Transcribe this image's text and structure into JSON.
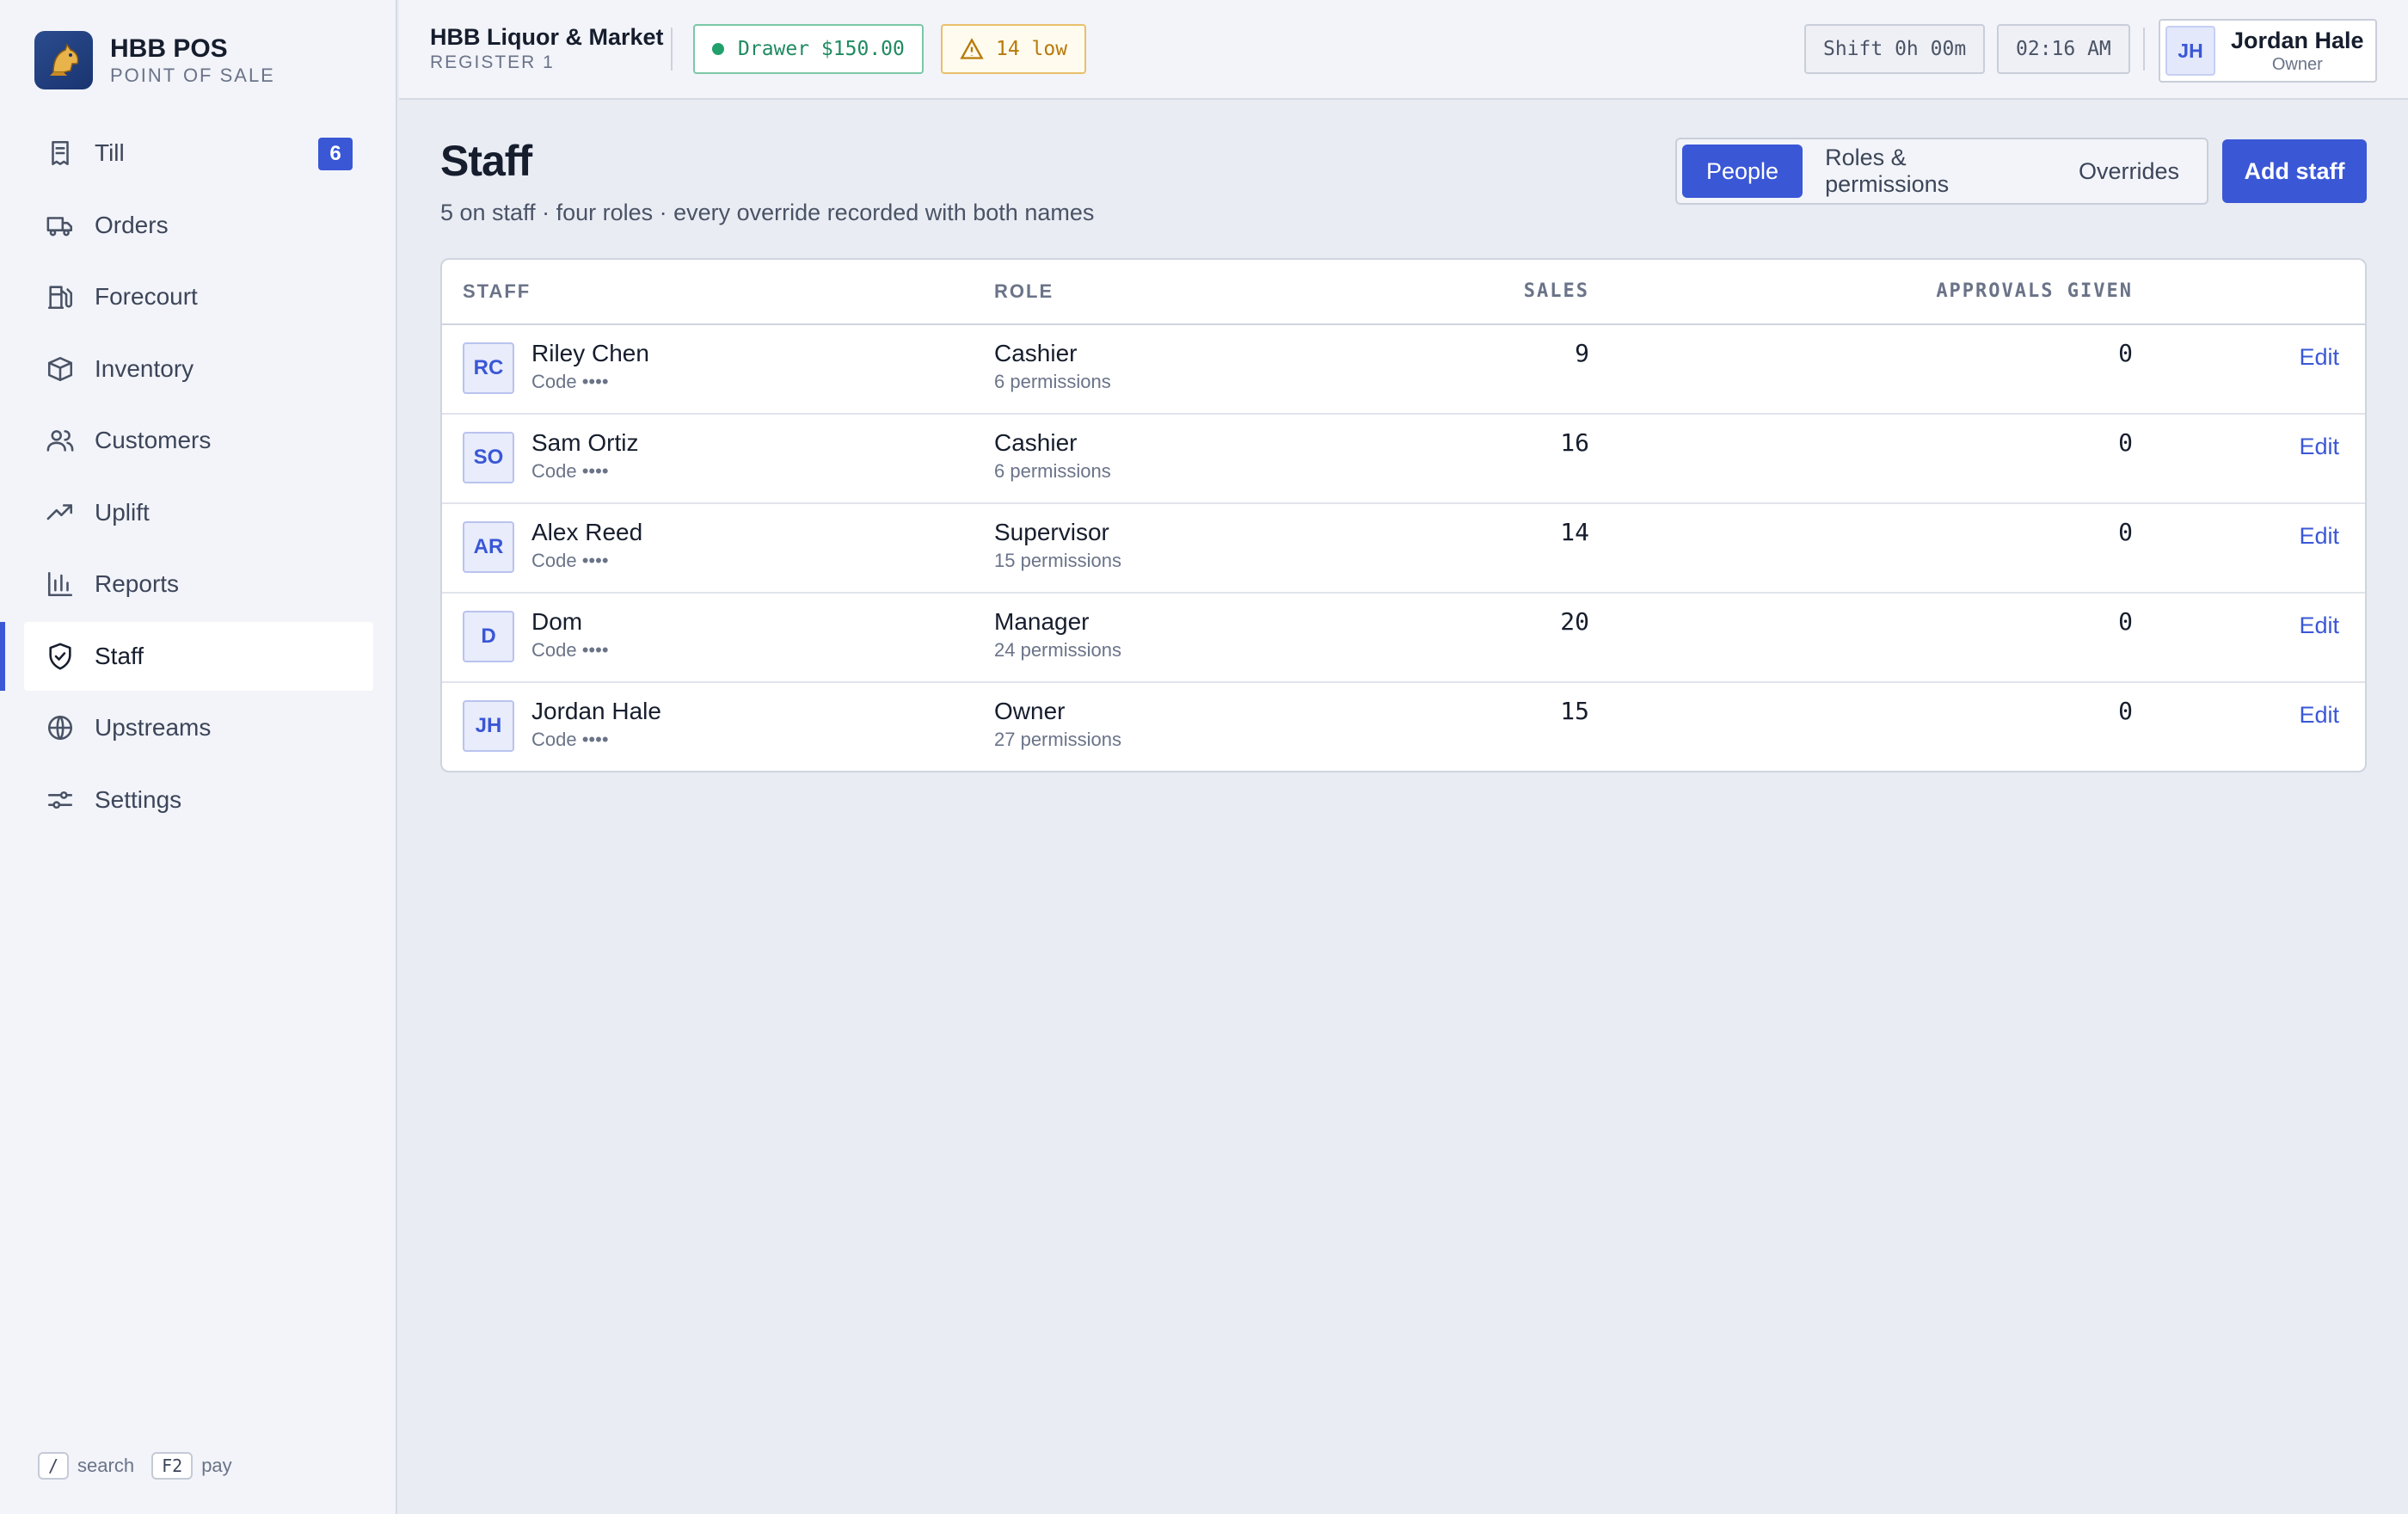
{
  "brand": {
    "title": "HBB POS",
    "subtitle": "POINT OF SALE"
  },
  "sidebar": {
    "items": [
      {
        "label": "Till",
        "icon": "receipt-icon",
        "badge": "6",
        "active": false
      },
      {
        "label": "Orders",
        "icon": "truck-icon",
        "active": false
      },
      {
        "label": "Forecourt",
        "icon": "fuel-pump-icon",
        "active": false
      },
      {
        "label": "Inventory",
        "icon": "box-icon",
        "active": false
      },
      {
        "label": "Customers",
        "icon": "users-icon",
        "active": false
      },
      {
        "label": "Uplift",
        "icon": "trending-up-icon",
        "active": false
      },
      {
        "label": "Reports",
        "icon": "bar-chart-icon",
        "active": false
      },
      {
        "label": "Staff",
        "icon": "shield-check-icon",
        "active": true
      },
      {
        "label": "Upstreams",
        "icon": "globe-icon",
        "active": false
      },
      {
        "label": "Settings",
        "icon": "sliders-icon",
        "active": false
      }
    ],
    "shortcuts": [
      {
        "key": "/",
        "label": "search"
      },
      {
        "key": "F2",
        "label": "pay"
      }
    ]
  },
  "topbar": {
    "store_name": "HBB Liquor & Market",
    "register": "REGISTER 1",
    "drawer": "Drawer $150.00",
    "low_stock": "14 low",
    "shift": "Shift 0h 00m",
    "time": "02:16 AM",
    "user": {
      "initials": "JH",
      "name": "Jordan Hale",
      "role": "Owner"
    }
  },
  "page": {
    "title": "Staff",
    "subtitle": "5 on staff · four roles · every override recorded with both names",
    "tabs": [
      {
        "label": "People",
        "active": true
      },
      {
        "label": "Roles & permissions",
        "active": false
      },
      {
        "label": "Overrides",
        "active": false
      }
    ],
    "add_button": "Add staff"
  },
  "table": {
    "headers": {
      "staff": "STAFF",
      "role": "ROLE",
      "sales": "SALES",
      "approvals": "APPROVALS GIVEN"
    },
    "edit_label": "Edit",
    "rows": [
      {
        "initials": "RC",
        "name": "Riley Chen",
        "code": "Code ••••",
        "role": "Cashier",
        "permissions": "6 permissions",
        "sales": "9",
        "approvals": "0"
      },
      {
        "initials": "SO",
        "name": "Sam Ortiz",
        "code": "Code ••••",
        "role": "Cashier",
        "permissions": "6 permissions",
        "sales": "16",
        "approvals": "0"
      },
      {
        "initials": "AR",
        "name": "Alex Reed",
        "code": "Code ••••",
        "role": "Supervisor",
        "permissions": "15 permissions",
        "sales": "14",
        "approvals": "0"
      },
      {
        "initials": "D",
        "name": "Dom",
        "code": "Code ••••",
        "role": "Manager",
        "permissions": "24 permissions",
        "sales": "20",
        "approvals": "0"
      },
      {
        "initials": "JH",
        "name": "Jordan Hale",
        "code": "Code ••••",
        "role": "Owner",
        "permissions": "27 permissions",
        "sales": "15",
        "approvals": "0"
      }
    ]
  },
  "colors": {
    "accent": "#3a57d6",
    "success": "#1f8a62",
    "warning": "#b77a08"
  }
}
